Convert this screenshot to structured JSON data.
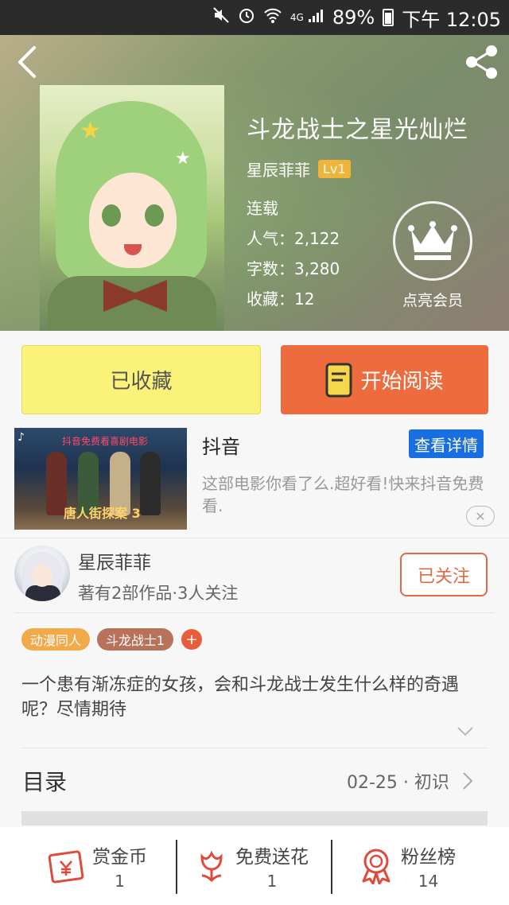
{
  "status_bar": {
    "network": "4G",
    "battery": "89%",
    "time": "下午 12:05"
  },
  "book": {
    "title": "斗龙战士之星光灿烂",
    "author": "星辰菲菲",
    "author_level": "Lv1",
    "status": "连载",
    "popularity": "人气：2,122",
    "word_count": "字数：3,280",
    "favorites": "收藏：12"
  },
  "vip": {
    "label": "点亮会员"
  },
  "actions": {
    "collected_label": "已收藏",
    "read_label": "开始阅读"
  },
  "ad": {
    "thumb_caption": "抖音免费看喜剧电影",
    "thumb_title": "唐人街探案",
    "thumb_number": "3",
    "title": "抖音",
    "detail_button": "查看详情",
    "description": "这部电影你看了么.超好看!快来抖音免费看."
  },
  "author_block": {
    "name": "星辰菲菲",
    "stats": "著有2部作品·3人关注",
    "follow_label": "已关注"
  },
  "tags": [
    {
      "label": "动漫同人",
      "color": "#f2a94a"
    },
    {
      "label": "斗龙战士1",
      "color": "#b9725a"
    }
  ],
  "tag_add_label": "+",
  "synopsis": "一个患有渐冻症的女孩，会和斗龙战士发生什么样的奇遇呢？尽情期待",
  "toc": {
    "label": "目录",
    "latest": "02-25 · 初识"
  },
  "bottom_bar": [
    {
      "label": "赏金币",
      "count": "1",
      "icon": "envelope-yen-icon"
    },
    {
      "label": "免费送花",
      "count": "1",
      "icon": "flower-icon"
    },
    {
      "label": "粉丝榜",
      "count": "14",
      "icon": "ribbon-medal-icon"
    }
  ],
  "colors": {
    "accent_orange": "#ee6b3d",
    "collected_yellow": "#fbf27a",
    "ad_blue": "#1a6fe0",
    "follow_red": "#e06a45"
  }
}
